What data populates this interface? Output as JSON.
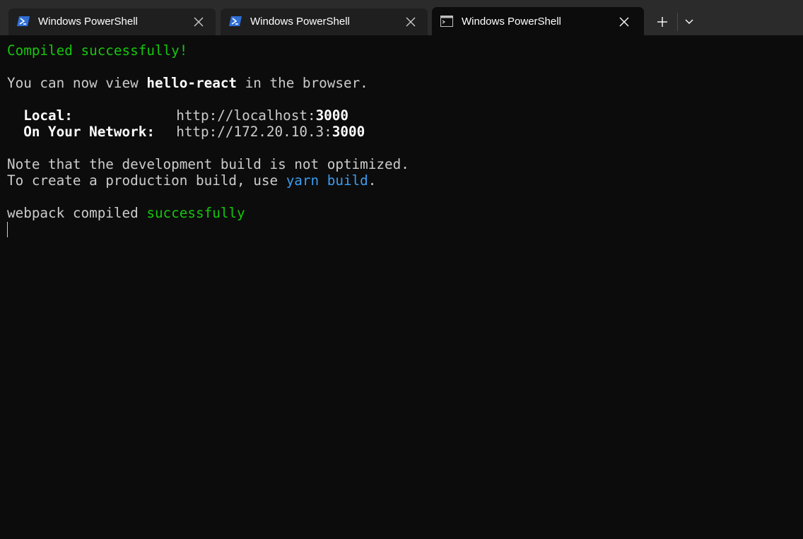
{
  "tabs": [
    {
      "title": "Windows PowerShell",
      "icon": "powershell-icon",
      "active": false
    },
    {
      "title": "Windows PowerShell",
      "icon": "powershell-icon",
      "active": false
    },
    {
      "title": "Windows PowerShell",
      "icon": "console-icon",
      "active": true
    }
  ],
  "tabbar": {
    "new_tab_icon": "plus-icon",
    "dropdown_icon": "chevron-down-icon"
  },
  "terminal": {
    "compiled": "Compiled successfully!",
    "view_prefix": "You can now view ",
    "app_name": "hello-react",
    "view_suffix": " in the browser.",
    "local_label": "Local:",
    "local_url_prefix": "http://localhost:",
    "local_port": "3000",
    "network_label": "On Your Network:",
    "network_url_prefix": "http://172.20.10.3:",
    "network_port": "3000",
    "note_line": "Note that the development build is not optimized.",
    "prod_prefix": "To create a production build, use ",
    "prod_command": "yarn build",
    "prod_suffix": ".",
    "webpack_prefix": "webpack compiled ",
    "webpack_status": "successfully"
  },
  "colors": {
    "background": "#0c0c0c",
    "tabbar": "#2b2b2b",
    "inactive_tab": "#1f1f1f",
    "foreground": "#cccccc",
    "success_green": "#16c60c",
    "command_blue": "#3b9cf0",
    "powershell_blue": "#2f6fd6"
  }
}
